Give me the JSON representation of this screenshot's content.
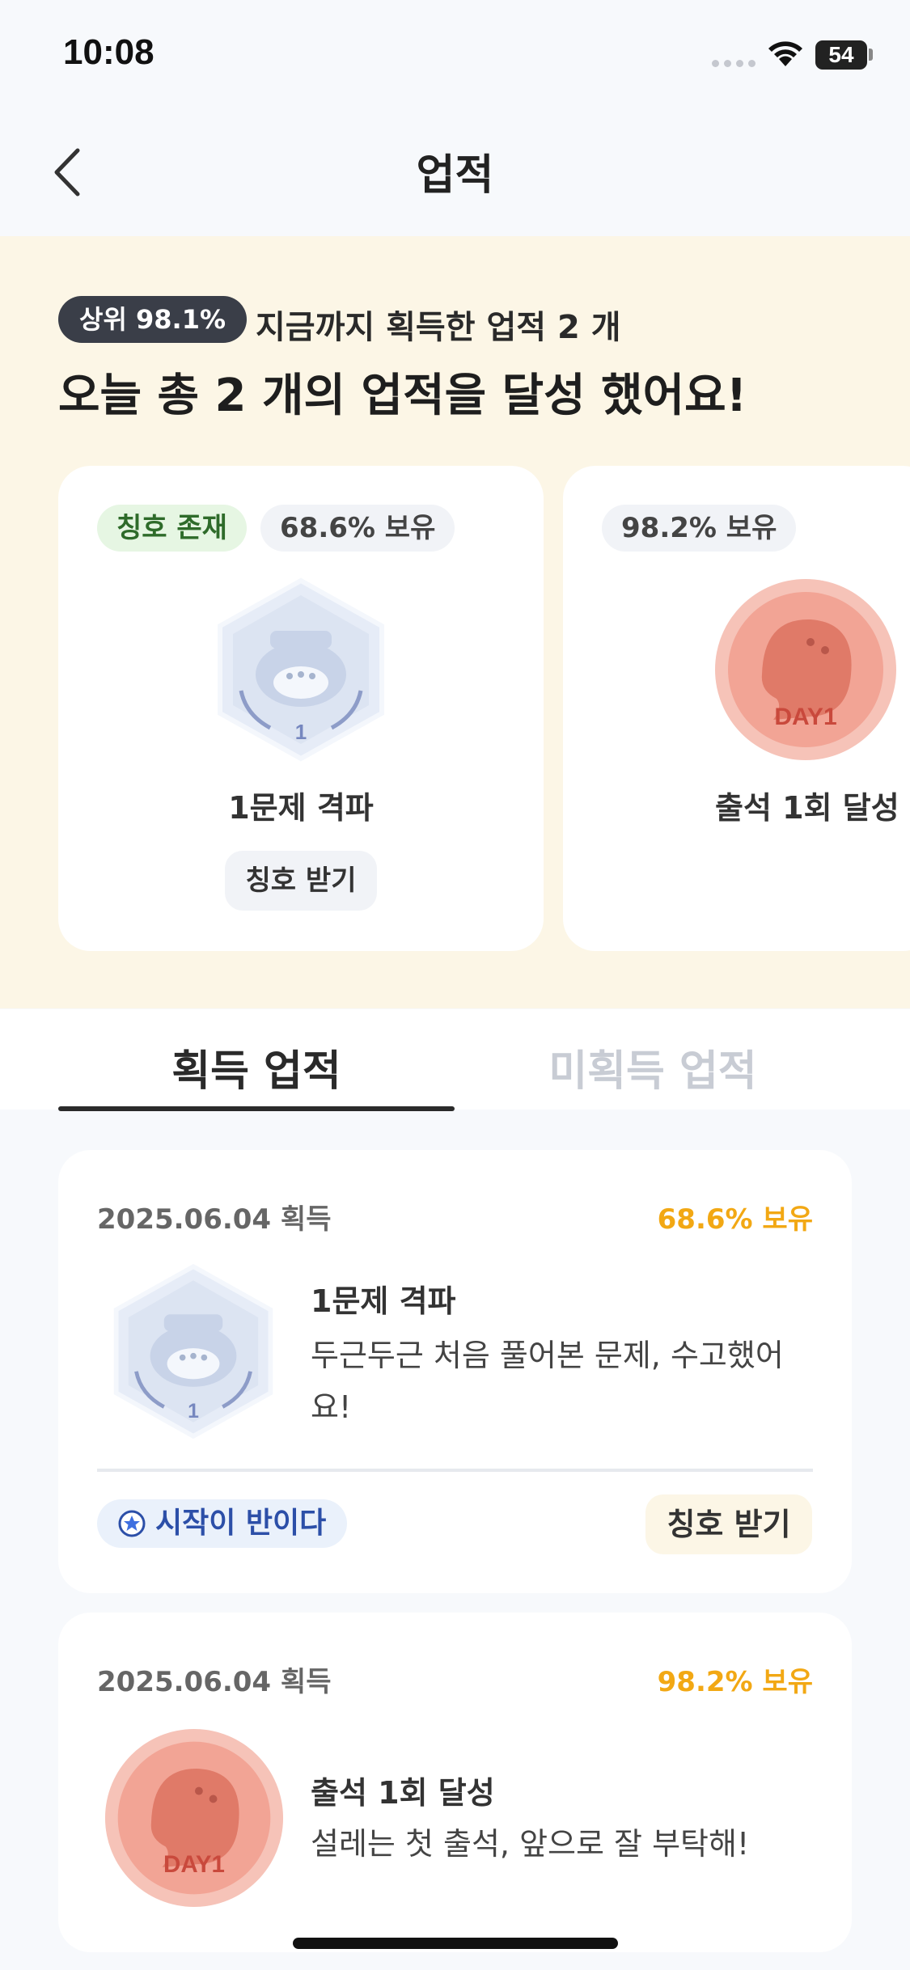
{
  "status_bar": {
    "time": "10:08",
    "battery": "54"
  },
  "nav": {
    "title": "업적"
  },
  "hero": {
    "rank_badge": "상위 98.1%",
    "total_text": "지금까지 획득한 업적 2 개",
    "headline": "오늘 총 2 개의 업적을 달성 했어요!"
  },
  "carousel": [
    {
      "title_pill": "칭호 존재",
      "ownership": "68.6% 보유",
      "badge_level": "1",
      "name": "1문제 격파",
      "button": "칭호 받기"
    },
    {
      "ownership": "98.2% 보유",
      "badge_text": "DAY1",
      "name": "출석 1회 달성"
    }
  ],
  "tabs": {
    "acquired": "획득 업적",
    "unacquired": "미획득 업적"
  },
  "list": [
    {
      "date": "2025.06.04 획득",
      "ownership": "68.6% 보유",
      "name": "1문제 격파",
      "desc_line1": "두근두근 처음 풀어본 문제, 수고했어",
      "desc_line2": "요!",
      "badge_level": "1",
      "title_chip": "시작이 반이다",
      "button": "칭호 받기"
    },
    {
      "date": "2025.06.04 획득",
      "ownership": "98.2% 보유",
      "name": "출석 1회 달성",
      "desc_line1": "설레는 첫 출석, 앞으로 잘 부탁해!",
      "badge_text": "DAY1"
    }
  ],
  "colors": {
    "hero_bg": "#FCF6E6",
    "accent_yellow": "#F2A814",
    "dark_badge": "#3A3E48",
    "title_chip_blue": "#2C4FA8"
  }
}
